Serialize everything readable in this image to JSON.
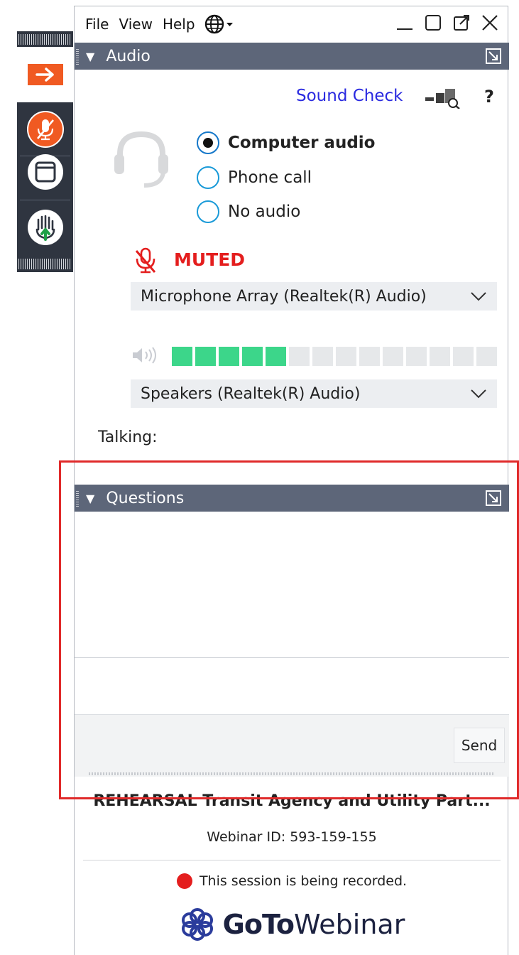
{
  "menu": {
    "file": "File",
    "view": "View",
    "help": "Help"
  },
  "audio_panel": {
    "title": "Audio",
    "sound_check": "Sound Check",
    "help_symbol": "?",
    "options": [
      {
        "label": "Computer audio",
        "selected": true
      },
      {
        "label": "Phone call",
        "selected": false
      },
      {
        "label": "No audio",
        "selected": false
      }
    ],
    "muted_label": "MUTED",
    "microphone": "Microphone Array (Realtek(R) Audio)",
    "speaker_level_fraction": 0.36,
    "speakers": "Speakers (Realtek(R) Audio)",
    "talking_label": "Talking:"
  },
  "questions_panel": {
    "title": "Questions",
    "send_label": "Send"
  },
  "footer": {
    "webinar_title": "REHEARSAL Transit Agency and Utility Part...",
    "webinar_id": "Webinar ID: 593-159-155",
    "recording_notice": "This session is being recorded.",
    "brand_goto": "GoTo",
    "brand_webinar": "Webinar"
  },
  "colors": {
    "header_bg": "#5d6679",
    "link_blue": "#2a2ae0",
    "muted_red": "#e41e1e",
    "meter_on": "#3cd68a",
    "meter_off": "#e6e8ea",
    "highlight_box": "#e02a2a",
    "strip_orange": "#f05a22",
    "hand_green": "#1fa047"
  }
}
